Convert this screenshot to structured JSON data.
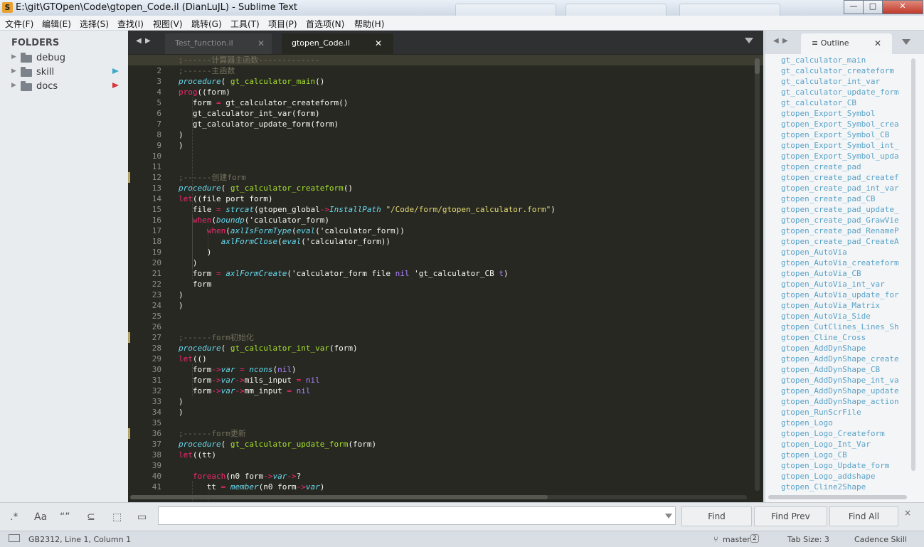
{
  "window": {
    "title": "E:\\git\\GTOpen\\Code\\gtopen_Code.il (DianLuJL) - Sublime Text"
  },
  "menu": [
    "文件(F)",
    "编辑(E)",
    "选择(S)",
    "查找(I)",
    "视图(V)",
    "跳转(G)",
    "工具(T)",
    "项目(P)",
    "首选项(N)",
    "帮助(H)"
  ],
  "sidebar": {
    "title": "FOLDERS",
    "items": [
      {
        "label": "debug",
        "badge": ""
      },
      {
        "label": "skill",
        "badge": "#3fa8c9"
      },
      {
        "label": "docs",
        "badge": "#d9343a"
      }
    ]
  },
  "tabs": [
    {
      "label": "Test_function.il",
      "active": false
    },
    {
      "label": "gtopen_Code.il",
      "active": true
    }
  ],
  "code": [
    [
      [
        "c-com",
        ";------计算器主函数-------------"
      ]
    ],
    [
      [
        "c-com",
        ";------主函数"
      ]
    ],
    [
      [
        "c-kw",
        "procedure"
      ],
      [
        "c-id",
        "( "
      ],
      [
        "c-fn",
        "gt_calculator_main"
      ],
      [
        "c-id",
        "()"
      ]
    ],
    [
      [
        "c-op",
        "prog"
      ],
      [
        "c-id",
        "((form)"
      ]
    ],
    [
      [
        "c-id",
        "   form "
      ],
      [
        "c-op",
        "="
      ],
      [
        "c-id",
        " gt_calculator_createform()"
      ]
    ],
    [
      [
        "c-id",
        "   gt_calculator_int_var(form)"
      ]
    ],
    [
      [
        "c-id",
        "   gt_calculator_update_form(form)"
      ]
    ],
    [
      [
        "c-id",
        ")"
      ]
    ],
    [
      [
        "c-id",
        ")"
      ]
    ],
    [],
    [],
    [
      [
        "c-com",
        ";------创建form"
      ]
    ],
    [
      [
        "c-kw",
        "procedure"
      ],
      [
        "c-id",
        "( "
      ],
      [
        "c-fn",
        "gt_calculator_createform"
      ],
      [
        "c-id",
        "()"
      ]
    ],
    [
      [
        "c-op",
        "let"
      ],
      [
        "c-id",
        "((file port form)"
      ]
    ],
    [
      [
        "c-id",
        "   file "
      ],
      [
        "c-op",
        "="
      ],
      [
        "c-id",
        " "
      ],
      [
        "c-kw",
        "strcat"
      ],
      [
        "c-id",
        "(gtopen_global"
      ],
      [
        "c-op",
        "->"
      ],
      [
        "c-kw",
        "InstallPath"
      ],
      [
        "c-id",
        " "
      ],
      [
        "c-str",
        "\"/Code/form/gtopen_calculator.form\""
      ],
      [
        "c-id",
        ")"
      ]
    ],
    [
      [
        "c-id",
        "   "
      ],
      [
        "c-op",
        "when"
      ],
      [
        "c-id",
        "("
      ],
      [
        "c-kw",
        "boundp"
      ],
      [
        "c-id",
        "('calculator_form)"
      ]
    ],
    [
      [
        "c-id",
        "      "
      ],
      [
        "c-op",
        "when"
      ],
      [
        "c-id",
        "("
      ],
      [
        "c-kw",
        "axlIsFormType"
      ],
      [
        "c-id",
        "("
      ],
      [
        "c-kw",
        "eval"
      ],
      [
        "c-id",
        "('calculator_form))"
      ]
    ],
    [
      [
        "c-id",
        "         "
      ],
      [
        "c-kw",
        "axlFormClose"
      ],
      [
        "c-id",
        "("
      ],
      [
        "c-kw",
        "eval"
      ],
      [
        "c-id",
        "('calculator_form))"
      ]
    ],
    [
      [
        "c-id",
        "      )"
      ]
    ],
    [
      [
        "c-id",
        "   )"
      ]
    ],
    [
      [
        "c-id",
        "   form "
      ],
      [
        "c-op",
        "="
      ],
      [
        "c-id",
        " "
      ],
      [
        "c-kw",
        "axlFormCreate"
      ],
      [
        "c-id",
        "('calculator_form file "
      ],
      [
        "c-con",
        "nil"
      ],
      [
        "c-id",
        " 'gt_calculator_CB "
      ],
      [
        "c-con",
        "t"
      ],
      [
        "c-id",
        ")"
      ]
    ],
    [
      [
        "c-id",
        "   form"
      ]
    ],
    [
      [
        "c-id",
        ")"
      ]
    ],
    [
      [
        "c-id",
        ")"
      ]
    ],
    [],
    [],
    [
      [
        "c-com",
        ";------form初始化"
      ]
    ],
    [
      [
        "c-kw",
        "procedure"
      ],
      [
        "c-id",
        "( "
      ],
      [
        "c-fn",
        "gt_calculator_int_var"
      ],
      [
        "c-id",
        "(form)"
      ]
    ],
    [
      [
        "c-op",
        "let"
      ],
      [
        "c-id",
        "(()"
      ]
    ],
    [
      [
        "c-id",
        "   form"
      ],
      [
        "c-op",
        "->"
      ],
      [
        "c-kw",
        "var"
      ],
      [
        "c-id",
        " "
      ],
      [
        "c-op",
        "="
      ],
      [
        "c-id",
        " "
      ],
      [
        "c-kw",
        "ncons"
      ],
      [
        "c-id",
        "("
      ],
      [
        "c-con",
        "nil"
      ],
      [
        "c-id",
        ")"
      ]
    ],
    [
      [
        "c-id",
        "   form"
      ],
      [
        "c-op",
        "->"
      ],
      [
        "c-kw",
        "var"
      ],
      [
        "c-op",
        "->"
      ],
      [
        "c-id",
        "mils_input "
      ],
      [
        "c-op",
        "="
      ],
      [
        "c-id",
        " "
      ],
      [
        "c-con",
        "nil"
      ]
    ],
    [
      [
        "c-id",
        "   form"
      ],
      [
        "c-op",
        "->"
      ],
      [
        "c-kw",
        "var"
      ],
      [
        "c-op",
        "->"
      ],
      [
        "c-id",
        "mm_input "
      ],
      [
        "c-op",
        "="
      ],
      [
        "c-id",
        " "
      ],
      [
        "c-con",
        "nil"
      ]
    ],
    [
      [
        "c-id",
        ")"
      ]
    ],
    [
      [
        "c-id",
        ")"
      ]
    ],
    [],
    [
      [
        "c-com",
        ";------form更新"
      ]
    ],
    [
      [
        "c-kw",
        "procedure"
      ],
      [
        "c-id",
        "( "
      ],
      [
        "c-fn",
        "gt_calculator_update_form"
      ],
      [
        "c-id",
        "(form)"
      ]
    ],
    [
      [
        "c-op",
        "let"
      ],
      [
        "c-id",
        "((tt)"
      ]
    ],
    [],
    [
      [
        "c-id",
        "   "
      ],
      [
        "c-op",
        "foreach"
      ],
      [
        "c-id",
        "(n0 form"
      ],
      [
        "c-op",
        "->"
      ],
      [
        "c-kw",
        "var"
      ],
      [
        "c-op",
        "->"
      ],
      [
        "c-id",
        "?"
      ]
    ],
    [
      [
        "c-id",
        "      tt "
      ],
      [
        "c-op",
        "="
      ],
      [
        "c-id",
        " "
      ],
      [
        "c-kw",
        "member"
      ],
      [
        "c-id",
        "(n0 form"
      ],
      [
        "c-op",
        "->"
      ],
      [
        "c-kw",
        "var"
      ],
      [
        "c-id",
        ")"
      ]
    ]
  ],
  "modified_lines": [
    1,
    12,
    27,
    36
  ],
  "outline": {
    "tab_label": "≡ Outline",
    "items": [
      "gt_calculator_main",
      "gt_calculator_createform",
      "gt_calculator_int_var",
      "gt_calculator_update_form",
      "gt_calculator_CB",
      "gtopen_Export_Symbol",
      "gtopen_Export_Symbol_crea",
      "gtopen_Export_Symbol_CB",
      "gtopen_Export_Symbol_int_",
      "gtopen_Export_Symbol_upda",
      "gtopen_create_pad",
      "gtopen_create_pad_createf",
      "gtopen_create_pad_int_var",
      "gtopen_create_pad_CB",
      "gtopen_create_pad_update_",
      "gtopen_create_pad_GrawVie",
      "gtopen_create_pad_RenameP",
      "gtopen_create_pad_CreateA",
      "gtopen_AutoVia",
      "gtopen_AutoVia_createform",
      "gtopen_AutoVia_CB",
      "gtopen_AutoVia_int_var",
      "gtopen_AutoVia_update_for",
      "gtopen_AutoVia_Matrix",
      "gtopen_AutoVia_Side",
      "gtopen_CutClines_Lines_Sh",
      "gtopen_Cline_Cross",
      "gtopen_AddDynShape",
      "gtopen_AddDynShape_create",
      "gtopen_AddDynShape_CB",
      "gtopen_AddDynShape_int_va",
      "gtopen_AddDynShape_update",
      "gtopen_AddDynShape_action",
      "gtopen_RunScrFile",
      "gtopen_Logo",
      "gtopen_Logo_Createform",
      "gtopen_Logo_Int_Var",
      "gtopen_Logo_CB",
      "gtopen_Logo_Update_form",
      "gtopen_Logo_addshape",
      "gtopen_Cline2Shape"
    ]
  },
  "findbar": {
    "options": [
      ".*",
      "Aa",
      "“”",
      "⊆",
      "⬚",
      "▭"
    ],
    "input_value": "",
    "find": "Find",
    "find_prev": "Find Prev",
    "find_all": "Find All",
    "close": "×"
  },
  "status": {
    "encoding_position": "GB2312, Line 1, Column 1",
    "branch": "master",
    "branch_count": "2",
    "tab_size": "Tab Size: 3",
    "syntax": "Cadence Skill"
  }
}
